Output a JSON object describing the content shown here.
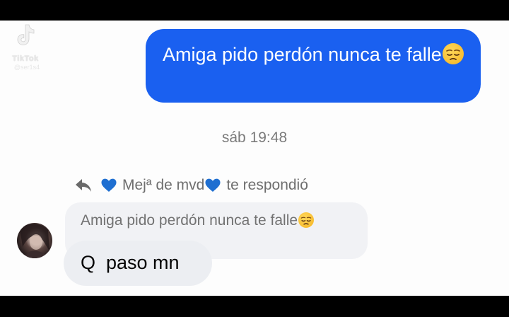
{
  "watermark": {
    "brand": "TikTok",
    "handle": "@ser1s4"
  },
  "conversation": {
    "sent_message": {
      "text": "Amiga pido perdón nunca te falle",
      "emoji": "pensive-face-emoji"
    },
    "timestamp": "sáb 19:48",
    "reply_notice": {
      "name": "Mejª de mvd",
      "suffix": "te respondió",
      "icon": "reply-arrow-icon",
      "name_decoration": "blue-heart-emoji"
    },
    "quoted_message": {
      "text": "Amiga pido perdón nunca te falle",
      "emoji": "pensive-face-emoji"
    },
    "received_message": {
      "text": "Q  paso mn"
    }
  },
  "colors": {
    "outgoing_bubble": "#1a60f0",
    "incoming_bubble": "#eceef2",
    "quoted_bubble": "#f1f2f5",
    "heart": "#1f6fd1"
  }
}
